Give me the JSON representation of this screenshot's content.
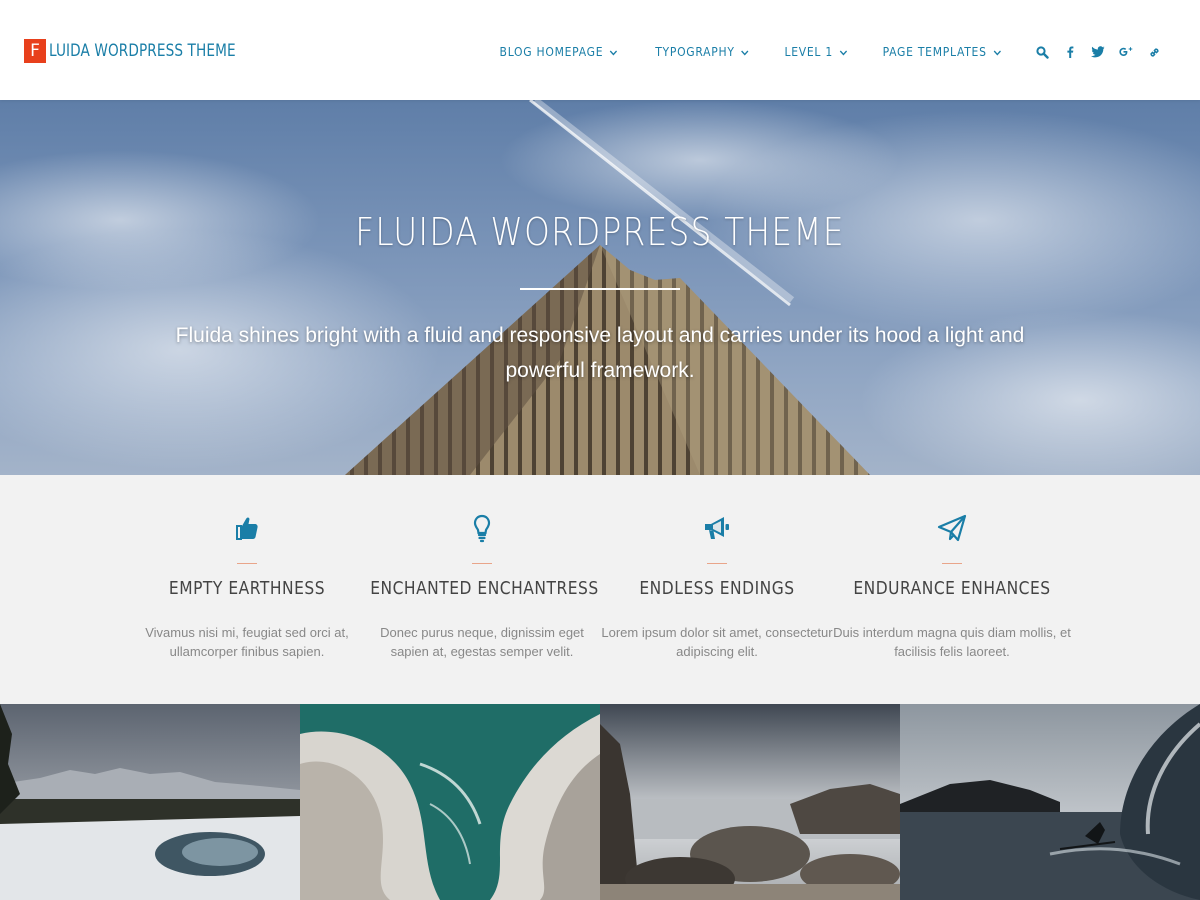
{
  "header": {
    "logo_letter": "F",
    "logo_text": "LUIDA WORDPRESS THEME",
    "nav": [
      {
        "label": "BLOG HOMEPAGE"
      },
      {
        "label": "TYPOGRAPHY"
      },
      {
        "label": "LEVEL 1"
      },
      {
        "label": "PAGE TEMPLATES"
      }
    ],
    "icons": [
      "search-icon",
      "facebook-icon",
      "twitter-icon",
      "google-plus-icon",
      "link-icon"
    ]
  },
  "hero": {
    "title": "FLUIDA WORDPRESS THEME",
    "subtitle": "Fluida shines bright with a fluid and responsive layout and carries under its hood a light and powerful framework."
  },
  "features": [
    {
      "icon": "thumbs-up-icon",
      "title": "EMPTY EARTHNESS",
      "text": "Vivamus nisi mi, feugiat sed orci at, ullamcorper finibus sapien."
    },
    {
      "icon": "lightbulb-icon",
      "title": "ENCHANTED ENCHANTRESS",
      "text": "Donec purus neque, dignissim eget sapien at, egestas semper velit."
    },
    {
      "icon": "megaphone-icon",
      "title": "ENDLESS ENDINGS",
      "text": "Lorem ipsum dolor sit amet, consectetur adipiscing elit."
    },
    {
      "icon": "paper-plane-icon",
      "title": "ENDURANCE ENHANCES",
      "text": "Duis interdum magna quis diam mollis, et facilisis felis laoreet."
    }
  ],
  "gallery": [
    {
      "name": "snowy-lake-image"
    },
    {
      "name": "rocky-coast-image"
    },
    {
      "name": "beach-rocks-image"
    },
    {
      "name": "surfer-wave-image"
    }
  ],
  "colors": {
    "accent": "#1a7ea7",
    "logo_badge": "#e8401c",
    "feature_rule": "#e9a58a",
    "features_bg": "#f2f2f2"
  }
}
